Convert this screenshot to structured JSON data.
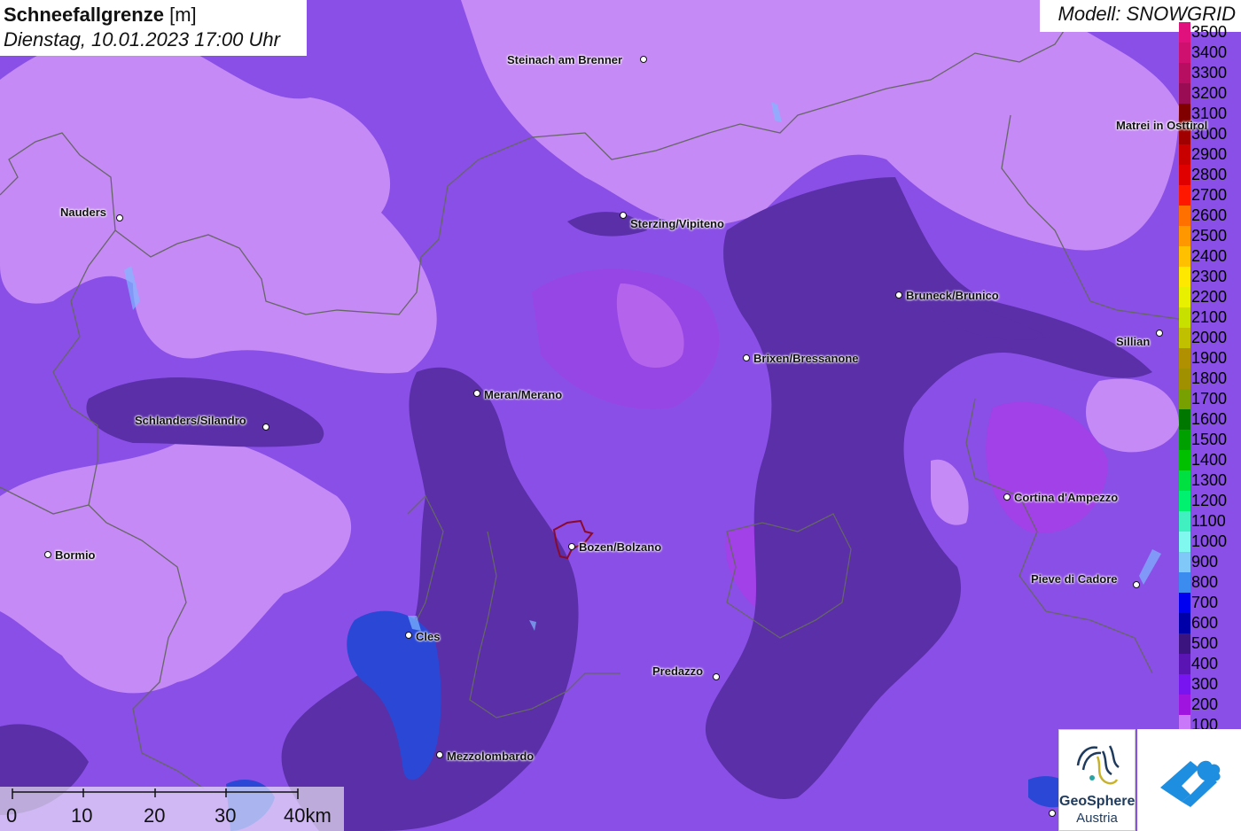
{
  "header": {
    "title_bold": "Schneefallgrenze",
    "title_unit": "[m]",
    "datetime": "Dienstag, 10.01.2023 17:00 Uhr",
    "model": "Modell: SNOWGRID"
  },
  "legend": {
    "items": [
      {
        "label": "3500",
        "color": "#e0107c"
      },
      {
        "label": "3400",
        "color": "#d0106e"
      },
      {
        "label": "3300",
        "color": "#b80e62"
      },
      {
        "label": "3200",
        "color": "#9a0c54"
      },
      {
        "label": "3100",
        "color": "#800000"
      },
      {
        "label": "3000",
        "color": "#a00000"
      },
      {
        "label": "2900",
        "color": "#c80000"
      },
      {
        "label": "2800",
        "color": "#e00000"
      },
      {
        "label": "2700",
        "color": "#ff1800"
      },
      {
        "label": "2600",
        "color": "#ff7000"
      },
      {
        "label": "2500",
        "color": "#ff9800"
      },
      {
        "label": "2400",
        "color": "#ffc000"
      },
      {
        "label": "2300",
        "color": "#ffe800"
      },
      {
        "label": "2200",
        "color": "#e8f000"
      },
      {
        "label": "2100",
        "color": "#c8e000"
      },
      {
        "label": "2000",
        "color": "#c0c000"
      },
      {
        "label": "1900",
        "color": "#b09000"
      },
      {
        "label": "1800",
        "color": "#a09000"
      },
      {
        "label": "1700",
        "color": "#78a000"
      },
      {
        "label": "1600",
        "color": "#007800"
      },
      {
        "label": "1500",
        "color": "#00a000"
      },
      {
        "label": "1400",
        "color": "#00c000"
      },
      {
        "label": "1300",
        "color": "#00e040"
      },
      {
        "label": "1200",
        "color": "#00f070"
      },
      {
        "label": "1100",
        "color": "#40f0c0"
      },
      {
        "label": "1000",
        "color": "#80f8f0"
      },
      {
        "label": "900",
        "color": "#80c8f8"
      },
      {
        "label": "800",
        "color": "#3c8cf0"
      },
      {
        "label": "700",
        "color": "#0000f0"
      },
      {
        "label": "600",
        "color": "#0000a8"
      },
      {
        "label": "500",
        "color": "#3c1480"
      },
      {
        "label": "400",
        "color": "#5a14b4"
      },
      {
        "label": "300",
        "color": "#7814f0"
      },
      {
        "label": "200",
        "color": "#a014e0"
      },
      {
        "label": "100",
        "color": "#c878f8"
      }
    ]
  },
  "cities": [
    {
      "name": "Steinach am Brenner"
    },
    {
      "name": "Nauders"
    },
    {
      "name": "Sterzing/Vipiteno"
    },
    {
      "name": "Matrei in Osttirol"
    },
    {
      "name": "Bruneck/Brunico"
    },
    {
      "name": "Sillian"
    },
    {
      "name": "Brixen/Bressanone"
    },
    {
      "name": "Meran/Merano"
    },
    {
      "name": "Schlanders/Silandro"
    },
    {
      "name": "Cortina d'Ampezzo"
    },
    {
      "name": "Bormio"
    },
    {
      "name": "Bozen/Bolzano"
    },
    {
      "name": "Pieve di Cadore"
    },
    {
      "name": "Cles"
    },
    {
      "name": "Predazzo"
    },
    {
      "name": "Mezzolombardo"
    },
    {
      "name": ""
    }
  ],
  "scale_bar": {
    "labels": [
      "0",
      "10",
      "20",
      "30",
      "40km"
    ]
  },
  "logos": {
    "geosphere_line1": "GeoSphere",
    "geosphere_line2": "Austria",
    "app_icon": "cloud-arrow-icon"
  },
  "colors": {
    "base": "#8a4fe6",
    "light": "#c58af5",
    "magenta": "#a53ee6",
    "dark": "#5a2fa8",
    "blue": "#2b47d6",
    "border": "#666666"
  }
}
